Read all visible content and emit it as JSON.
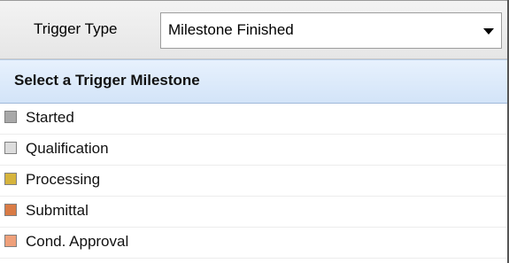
{
  "toolbar": {
    "trigger_type_label": "Trigger Type",
    "trigger_type_value": "Milestone Finished",
    "dropdown_icon": "chevron-down-icon"
  },
  "section": {
    "title": "Select a Trigger Milestone"
  },
  "milestones": [
    {
      "label": "Started",
      "swatch_color": "#a8a8a8"
    },
    {
      "label": "Qualification",
      "swatch_color": "#dcdcdc"
    },
    {
      "label": "Processing",
      "swatch_color": "#d6b43d"
    },
    {
      "label": "Submittal",
      "swatch_color": "#d97b45"
    },
    {
      "label": "Cond. Approval",
      "swatch_color": "#efa07a"
    }
  ]
}
